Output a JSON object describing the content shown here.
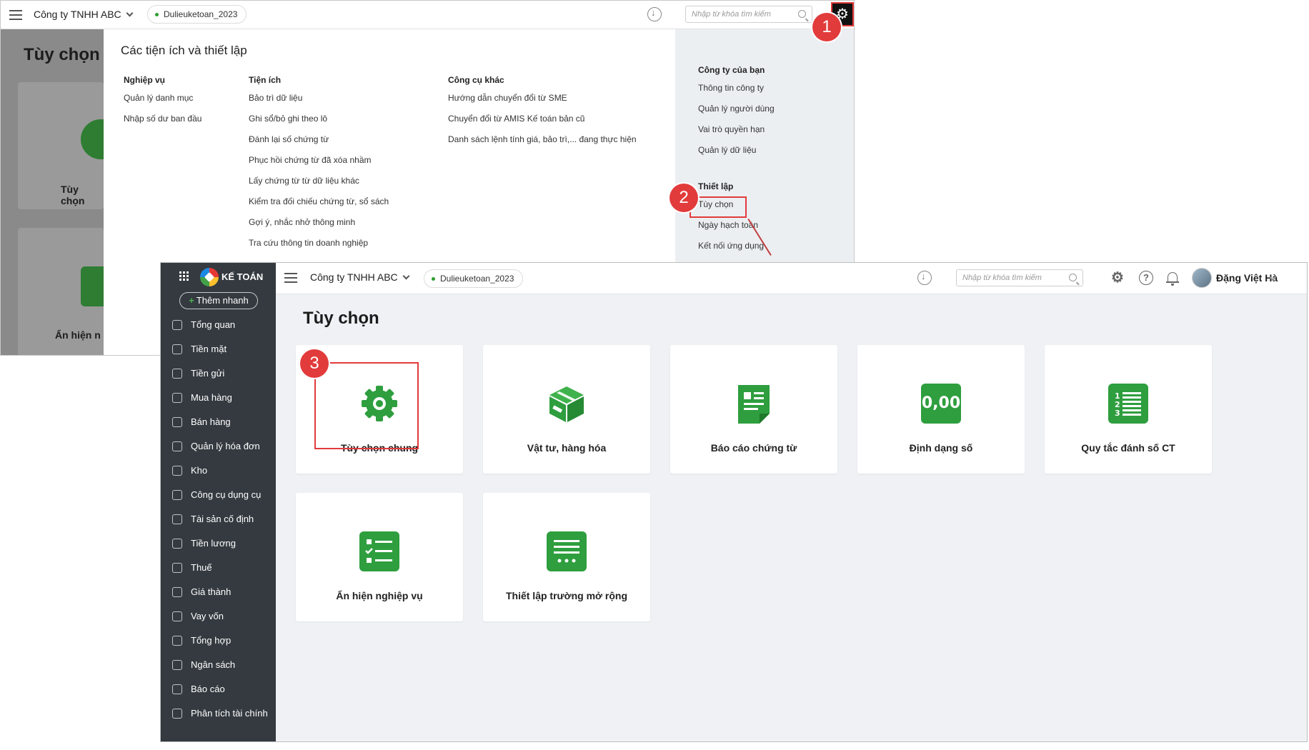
{
  "back": {
    "company": "Công ty TNHH ABC",
    "database": "Dulieuketoan_2023",
    "search_placeholder": "Nhập từ khóa tìm kiếm",
    "page_title": "Tùy chọn",
    "card1_label": "Tùy chọn",
    "card2_label": "Ẩn hiện n",
    "menu_title": "Các tiện ích và thiết lập",
    "col_nghiepvu": {
      "header": "Nghiệp vụ",
      "items": [
        "Quản lý danh mục",
        "Nhập số dư ban đầu"
      ]
    },
    "col_tienich": {
      "header": "Tiện ích",
      "items": [
        "Bảo trì dữ liệu",
        "Ghi sổ/bỏ ghi theo lô",
        "Đánh lại số chứng từ",
        "Phục hồi chứng từ đã xóa nhầm",
        "Lấy chứng từ từ dữ liệu khác",
        "Kiểm tra đối chiếu chứng từ, sổ sách",
        "Gợi ý, nhắc nhở thông minh",
        "Tra cứu thông tin doanh nghiệp"
      ]
    },
    "col_congcu": {
      "header": "Công cụ khác",
      "items": [
        "Hướng dẫn chuyển đổi từ SME",
        "Chuyển đổi từ AMIS Kế toán bản cũ",
        "Danh sách lệnh tính giá, bảo trì,... đang thực hiện"
      ]
    },
    "company_section": {
      "header": "Công ty của bạn",
      "items": [
        "Thông tin công ty",
        "Quản lý người dùng",
        "Vai trò quyền hạn",
        "Quản lý dữ liệu"
      ]
    },
    "setup_section": {
      "header": "Thiết lập",
      "items": [
        "Tùy chọn",
        "Ngày hạch toán",
        "Kết nối ứng dụng"
      ]
    }
  },
  "badges": [
    "1",
    "2",
    "3"
  ],
  "front": {
    "logo_text": "KẾ TOÁN",
    "quick_add": "Thêm nhanh",
    "nav": [
      "Tổng quan",
      "Tiền mặt",
      "Tiền gửi",
      "Mua hàng",
      "Bán hàng",
      "Quản lý hóa đơn",
      "Kho",
      "Công cụ dụng cụ",
      "Tài sản cố định",
      "Tiền lương",
      "Thuế",
      "Giá thành",
      "Vay vốn",
      "Tổng hợp",
      "Ngân sách",
      "Báo cáo",
      "Phân tích tài chính"
    ],
    "company": "Công ty TNHH ABC",
    "database": "Dulieuketoan_2023",
    "search_placeholder": "Nhập từ khóa tìm kiếm",
    "username": "Đặng Việt Hà",
    "page_title": "Tùy chọn",
    "cards": [
      {
        "label": "Tùy chọn chung",
        "icon": "gear-icon"
      },
      {
        "label": "Vật tư, hàng hóa",
        "icon": "box-icon"
      },
      {
        "label": "Báo cáo chứng từ",
        "icon": "document-icon"
      },
      {
        "label": "Định dạng số",
        "icon": "number-format-icon",
        "icon_text": "0,00"
      },
      {
        "label": "Quy tắc đánh số CT",
        "icon": "numbered-list-icon"
      },
      {
        "label": "Ẩn hiện nghiệp vụ",
        "icon": "checklist-icon"
      },
      {
        "label": "Thiết lập trường mở rộng",
        "icon": "extend-fields-icon"
      }
    ],
    "accent_green": "#2e9e3e",
    "highlight_red": "#e23b3b"
  }
}
